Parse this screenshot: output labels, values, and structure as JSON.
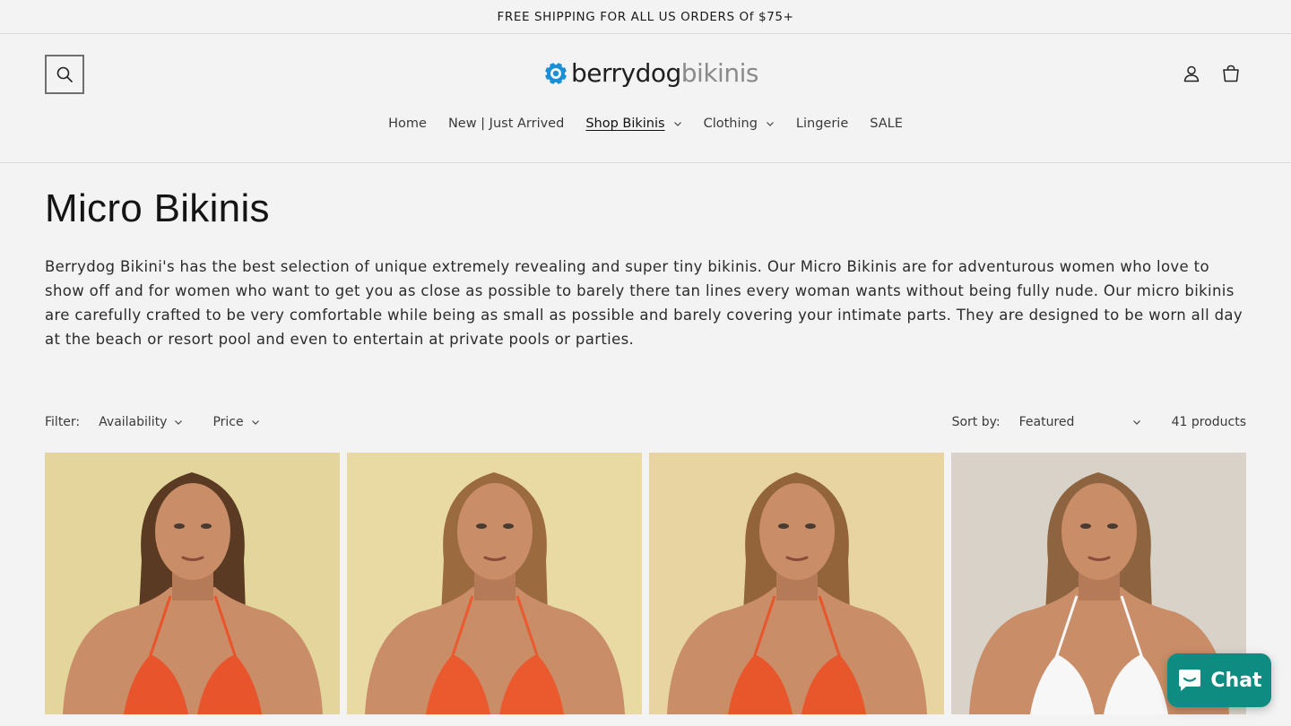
{
  "announcement": {
    "text": "FREE SHIPPING FOR ALL US ORDERS Of $75+"
  },
  "header": {
    "logo": {
      "part1": "berrydog",
      "part2": "bikinis",
      "accent": "#1a8fd6"
    },
    "icons": [
      "search-icon",
      "account-icon",
      "cart-icon"
    ]
  },
  "nav": {
    "items": [
      {
        "label": "Home",
        "has_dropdown": false,
        "active": false
      },
      {
        "label": "New | Just Arrived",
        "has_dropdown": false,
        "active": false
      },
      {
        "label": "Shop Bikinis",
        "has_dropdown": true,
        "active": true
      },
      {
        "label": "Clothing",
        "has_dropdown": true,
        "active": false
      },
      {
        "label": "Lingerie",
        "has_dropdown": false,
        "active": false
      },
      {
        "label": "SALE",
        "has_dropdown": false,
        "active": false
      }
    ]
  },
  "collection": {
    "title": "Micro Bikinis",
    "description": "Berrydog Bikini's has the best selection of unique extremely revealing and super tiny bikinis. Our Micro Bikinis are for adventurous women who love to show off and for women who want to get you as close as possible to barely there tan lines every woman wants without being fully nude. Our micro bikinis are carefully crafted to be very comfortable while being as small as possible and barely covering your intimate parts. They are designed to be worn all day at the beach or resort pool and even to entertain at private pools or parties."
  },
  "filters": {
    "label": "Filter:",
    "facets": [
      "Availability",
      "Price"
    ],
    "sort_label": "Sort by:",
    "sort_value": "Featured",
    "count": "41 products"
  },
  "products": [
    {
      "background": "#e3d59c",
      "hair": "#5a3a22",
      "swimsuit": "#e8542c"
    },
    {
      "background": "#e9d9a3",
      "hair": "#9b6a3e",
      "swimsuit": "#ea5a2e"
    },
    {
      "background": "#e7d4a0",
      "hair": "#93643a",
      "swimsuit": "#e8562c"
    },
    {
      "background": "#d8d2c8",
      "hair": "#8e6440",
      "swimsuit": "#f7f7f7"
    }
  ],
  "chat": {
    "label": "Chat",
    "color": "#0f8c82"
  }
}
